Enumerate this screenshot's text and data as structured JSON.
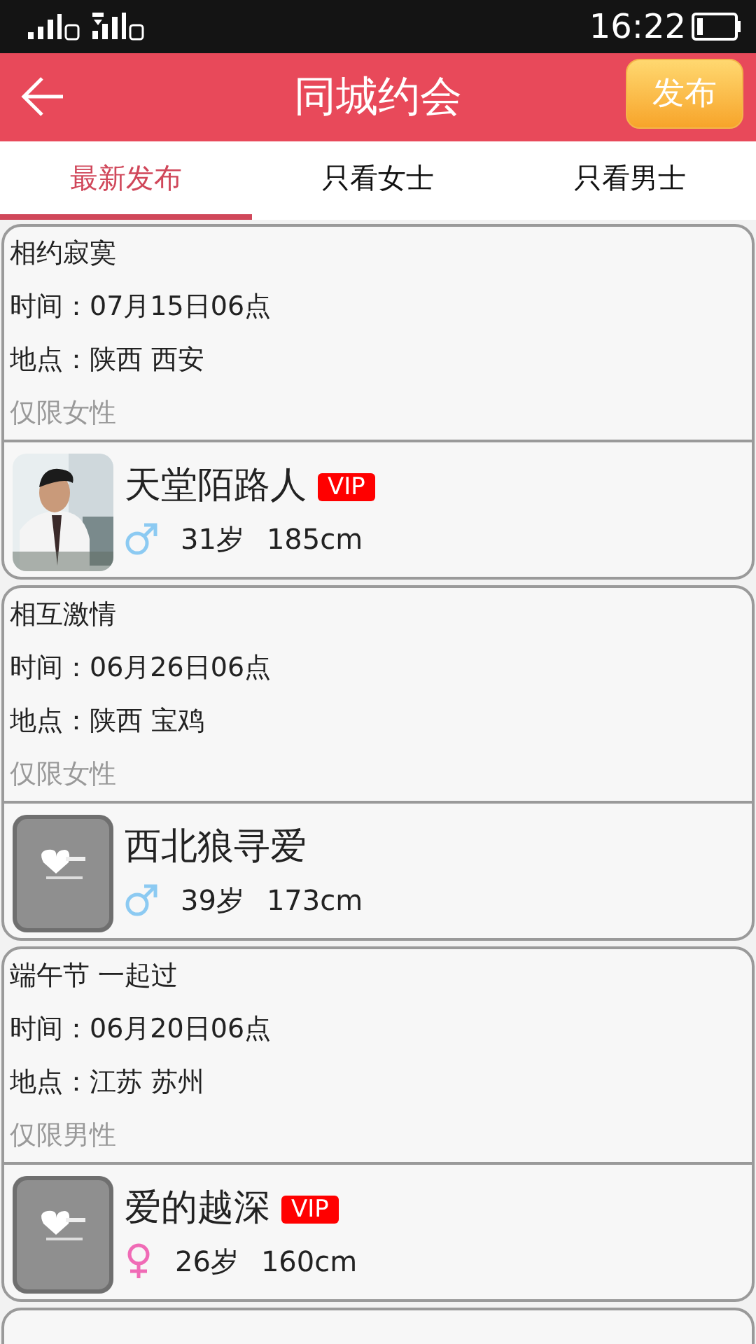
{
  "status_bar": {
    "time": "16:22"
  },
  "header": {
    "title": "同城约会",
    "action": "发布"
  },
  "tabs": [
    {
      "label": "最新发布",
      "selected": true
    },
    {
      "label": "只看女士",
      "selected": false
    },
    {
      "label": "只看男士",
      "selected": false
    }
  ],
  "posts": [
    {
      "title": "相约寂寞",
      "time": "时间：07月15日06点",
      "place": "地点：陕西 西安",
      "restriction": "仅限女性",
      "user": {
        "name": "天堂陌路人",
        "vip": "VIP",
        "gender": {
          "kind": "male"
        },
        "age": "31岁",
        "height": "185cm"
      }
    },
    {
      "title": "相互激情",
      "time": "时间：06月26日06点",
      "place": "地点：陕西 宝鸡",
      "restriction": "仅限女性",
      "user": {
        "name": "西北狼寻爱",
        "avatar": {
          "kind": "placeholder"
        },
        "gender": {
          "kind": "male"
        },
        "age": "39岁",
        "height": "173cm"
      }
    },
    {
      "title": "端午节 一起过",
      "time": "时间：06月20日06点",
      "place": "地点：江苏 苏州",
      "restriction": "仅限男性",
      "user": {
        "name": "爱的越深",
        "vip": "VIP",
        "avatar": {
          "kind": "placeholder"
        },
        "gender": {
          "kind": "female"
        },
        "age": "26岁",
        "height": "160cm"
      }
    },
    {
      "partial": true
    }
  ]
}
